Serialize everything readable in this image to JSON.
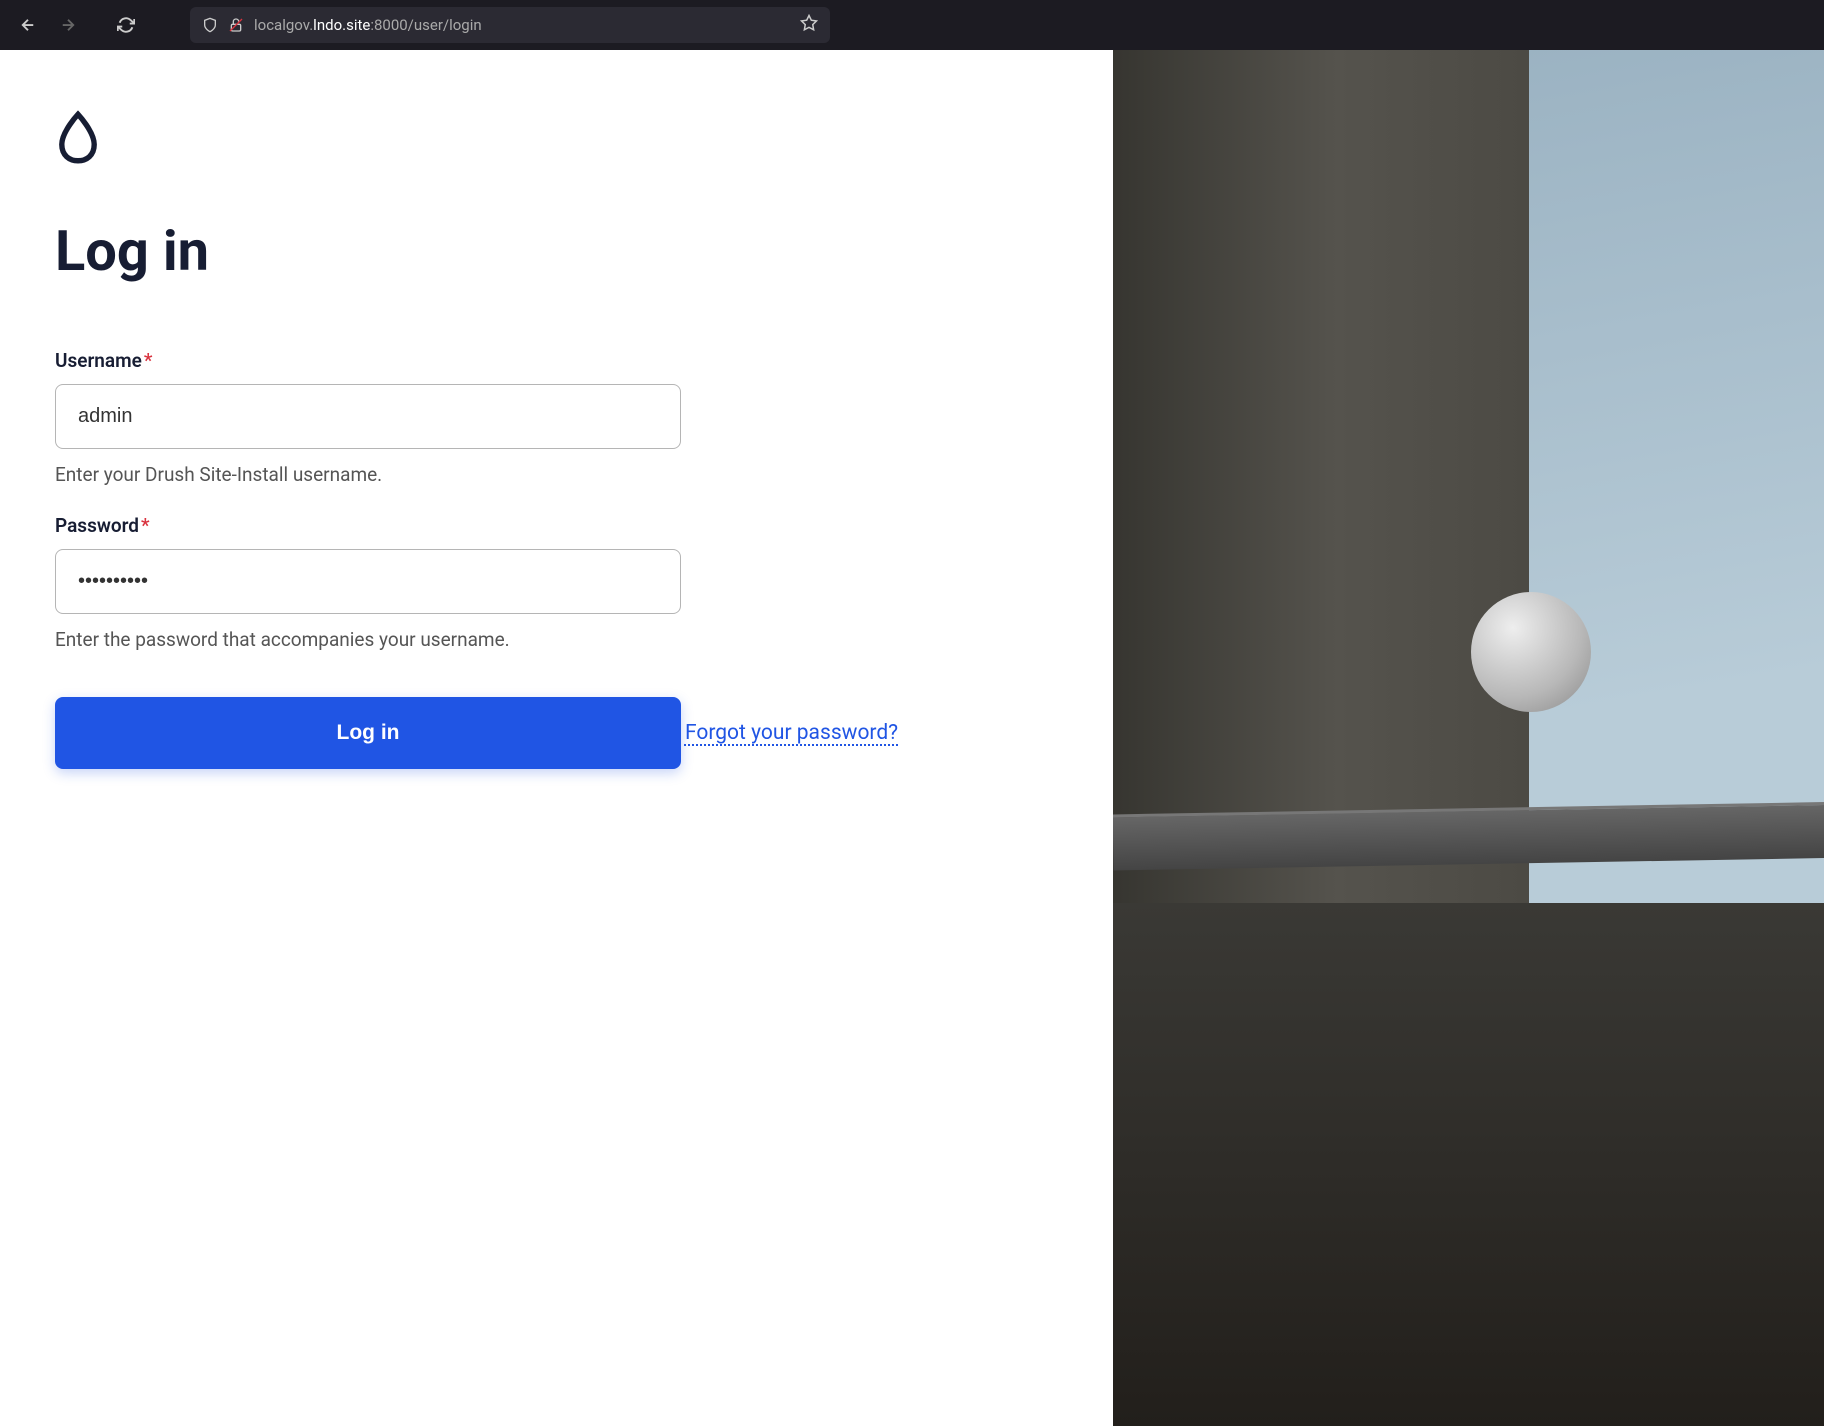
{
  "browser": {
    "url_prefix": "localgov.",
    "url_host": "lndo.site",
    "url_suffix": ":8000/user/login"
  },
  "page": {
    "title": "Log in"
  },
  "form": {
    "username": {
      "label": "Username",
      "value": "admin",
      "help": "Enter your Drush Site-Install username."
    },
    "password": {
      "label": "Password",
      "value": "••••••••••",
      "help": "Enter the password that accompanies your username."
    },
    "submit_label": "Log in",
    "forgot_link": "Forgot your password?"
  }
}
